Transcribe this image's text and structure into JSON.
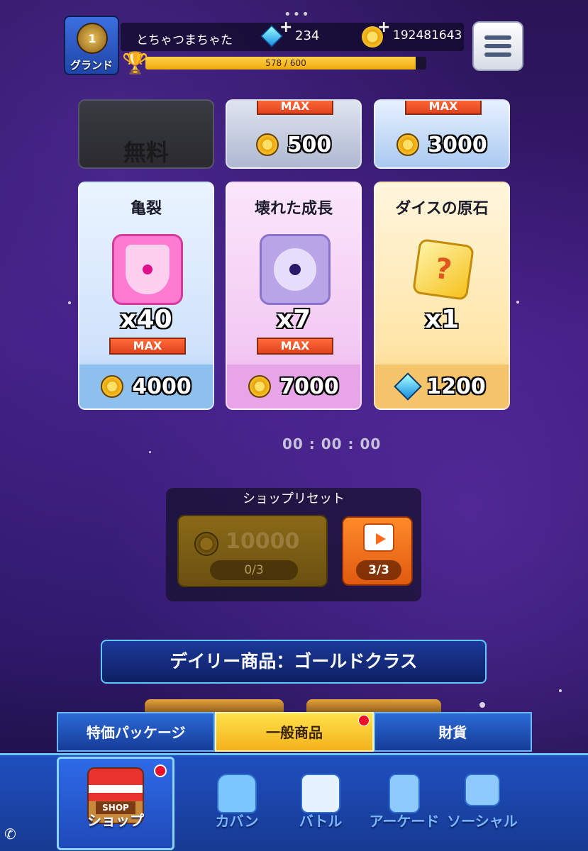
{
  "header": {
    "rank_label": "グランド",
    "rank_number": "1",
    "player_name": "とちゃつまちゃた",
    "gems": "234",
    "coins": "192481643",
    "exp_text": "578 / 600",
    "exp_progress": 0.963
  },
  "top_cards": [
    {
      "label": "無料",
      "max": ""
    },
    {
      "label": "500",
      "max": "MAX"
    },
    {
      "label": "3000",
      "max": "MAX"
    }
  ],
  "cards": [
    {
      "title": "亀裂",
      "qty": "x40",
      "max": "MAX",
      "price": "4000",
      "currency": "coin"
    },
    {
      "title": "壊れた成長",
      "qty": "x7",
      "max": "MAX",
      "price": "7000",
      "currency": "coin"
    },
    {
      "title": "ダイスの原石",
      "qty": "x1",
      "max": "",
      "price": "1200",
      "currency": "gem"
    }
  ],
  "timer": "00 : 00 : 00",
  "shop_reset": {
    "title": "ショップリセット",
    "gold_price": "10000",
    "gold_count": "0/3",
    "ad_count": "3/3"
  },
  "daily_banner": "デイリー商品：ゴールドクラス",
  "tabs": [
    {
      "label": "特価パッケージ"
    },
    {
      "label": "一般商品"
    },
    {
      "label": "財貨"
    }
  ],
  "nav": [
    {
      "label": "ショップ",
      "icon": "shop-icon",
      "shop_sign": "SHOP"
    },
    {
      "label": "カバン",
      "icon": "bag-icon"
    },
    {
      "label": "バトル",
      "icon": "dice-icon"
    },
    {
      "label": "アーケード",
      "icon": "arcade-icon"
    },
    {
      "label": "ソーシャル",
      "icon": "social-icon"
    }
  ],
  "colors": {
    "accent_gold": "#f4b21c",
    "nav_blue": "#1f4fbf",
    "max_red": "#e0431e"
  }
}
